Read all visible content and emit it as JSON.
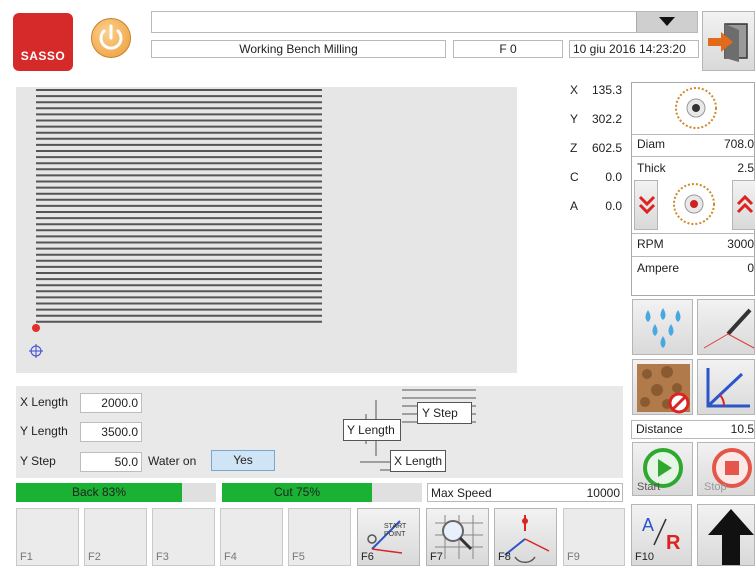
{
  "header": {
    "logo_text": "SASSO",
    "program_name": "Working Bench Milling",
    "feed": "F 0",
    "datetime": "10 giu 2016 14:23:20",
    "dropdown_value": ""
  },
  "coords": [
    {
      "axis": "X",
      "value": "135.3"
    },
    {
      "axis": "Y",
      "value": "302.2"
    },
    {
      "axis": "Z",
      "value": "602.5"
    },
    {
      "axis": "C",
      "value": "0.0"
    },
    {
      "axis": "A",
      "value": "0.0"
    }
  ],
  "tool": {
    "diam_label": "Diam",
    "diam_value": "708.0",
    "thick_label": "Thick",
    "thick_value": "2.5",
    "rpm_label": "RPM",
    "rpm_value": "3000",
    "ampere_label": "Ampere",
    "ampere_value": "0"
  },
  "distance": {
    "label": "Distance",
    "value": "10.5"
  },
  "start_label": "Start",
  "stop_label": "Stop",
  "params": {
    "x_length_label": "X Length",
    "x_length_value": "2000.0",
    "y_length_label": "Y Length",
    "y_length_value": "3500.0",
    "y_step_label": "Y Step",
    "y_step_value": "50.0",
    "water_label": "Water on",
    "water_value": "Yes"
  },
  "diagram": {
    "y_length": "Y Length",
    "y_step": "Y Step",
    "x_length": "X Length"
  },
  "progress": {
    "back_label": "Back 83%",
    "back_fraction": 0.83,
    "cut_label": "Cut 75%",
    "cut_fraction": 0.75,
    "max_speed_label": "Max Speed",
    "max_speed_value": "10000"
  },
  "fkeys": [
    "F1",
    "F2",
    "F3",
    "F4",
    "F5",
    "F6",
    "F7",
    "F8",
    "F9",
    "F10"
  ],
  "f6_caption": "START POINT",
  "colors": {
    "logo_red": "#d62a2a",
    "power_orange": "#f1a84b",
    "progress_green": "#19b233",
    "yes_blue": "#cfe4f5",
    "start_green": "#2fa82f",
    "stop_red": "#e4554a"
  }
}
